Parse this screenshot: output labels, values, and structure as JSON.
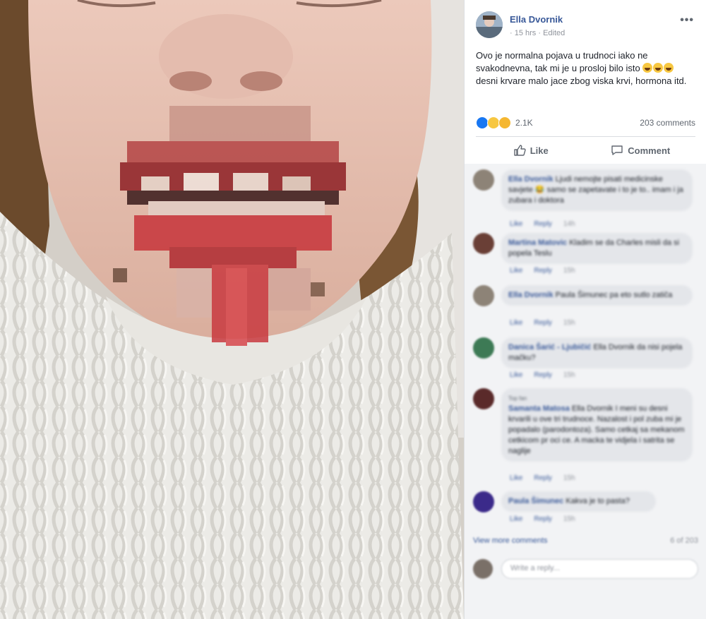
{
  "post": {
    "author": "Ella Dvornik",
    "meta": "· 15 hrs · Edited",
    "text_line1": "Ovo je normalna pojava u trudnoci iako ne",
    "text_line2": "svakodnevna, tak mi je u prosloj bilo isto",
    "text_line3": "desni krvare malo jace zbog viska krvi, hormona itd.",
    "more_icon": "•••"
  },
  "reactions": {
    "count": "2.1K",
    "comments_count": "203 comments"
  },
  "actions": {
    "like": "Like",
    "comment": "Comment"
  },
  "comments": [
    {
      "author": "Ella Dvornik",
      "text": "Ljudi nemojte pisati medicinske savjete 😂 samo se zapetavate i to je to.. imam i ja zubara i doktora",
      "like": "Like",
      "reply": "Reply",
      "time": "14h"
    },
    {
      "author": "Martina Matovic",
      "text": "Kladim se da Charles misli da si popela Teslu",
      "like": "Like",
      "reply": "Reply",
      "time": "15h"
    },
    {
      "author": "Ella Dvornik",
      "text": "Paula Šimunec pa eto sutlo zatiča",
      "like": "Like",
      "reply": "Reply",
      "time": "15h"
    },
    {
      "author": "Danica Šarić - Ljubičić",
      "text": "Ella Dvornik da nisi pojela mačku?",
      "like": "Like",
      "reply": "Reply",
      "time": "15h"
    },
    {
      "author": "Samanta Matosa",
      "text": "Ella Dvornik I meni su desni krvarili u ove tri trudnoce. Nazalost i pol zuba mi je popadalo (parodontoza). Samo cetkaj sa mekanom cetkicom pr oci ce. A macka te vidjela i satrita se naglije",
      "like": "Like",
      "reply": "Reply",
      "time": "15h",
      "label": "Top fan"
    },
    {
      "author": "Paula Šimunec",
      "text": "Kakva je to pasta?",
      "like": "Like",
      "reply": "Reply",
      "time": "15h"
    }
  ],
  "view_more": "View more comments",
  "pagination": "6 of 203",
  "reply_placeholder": "Write a reply...",
  "colors": {
    "link": "#385898",
    "text": "#1d2129",
    "muted": "#90949c",
    "comment_bg": "#f2f3f5"
  }
}
